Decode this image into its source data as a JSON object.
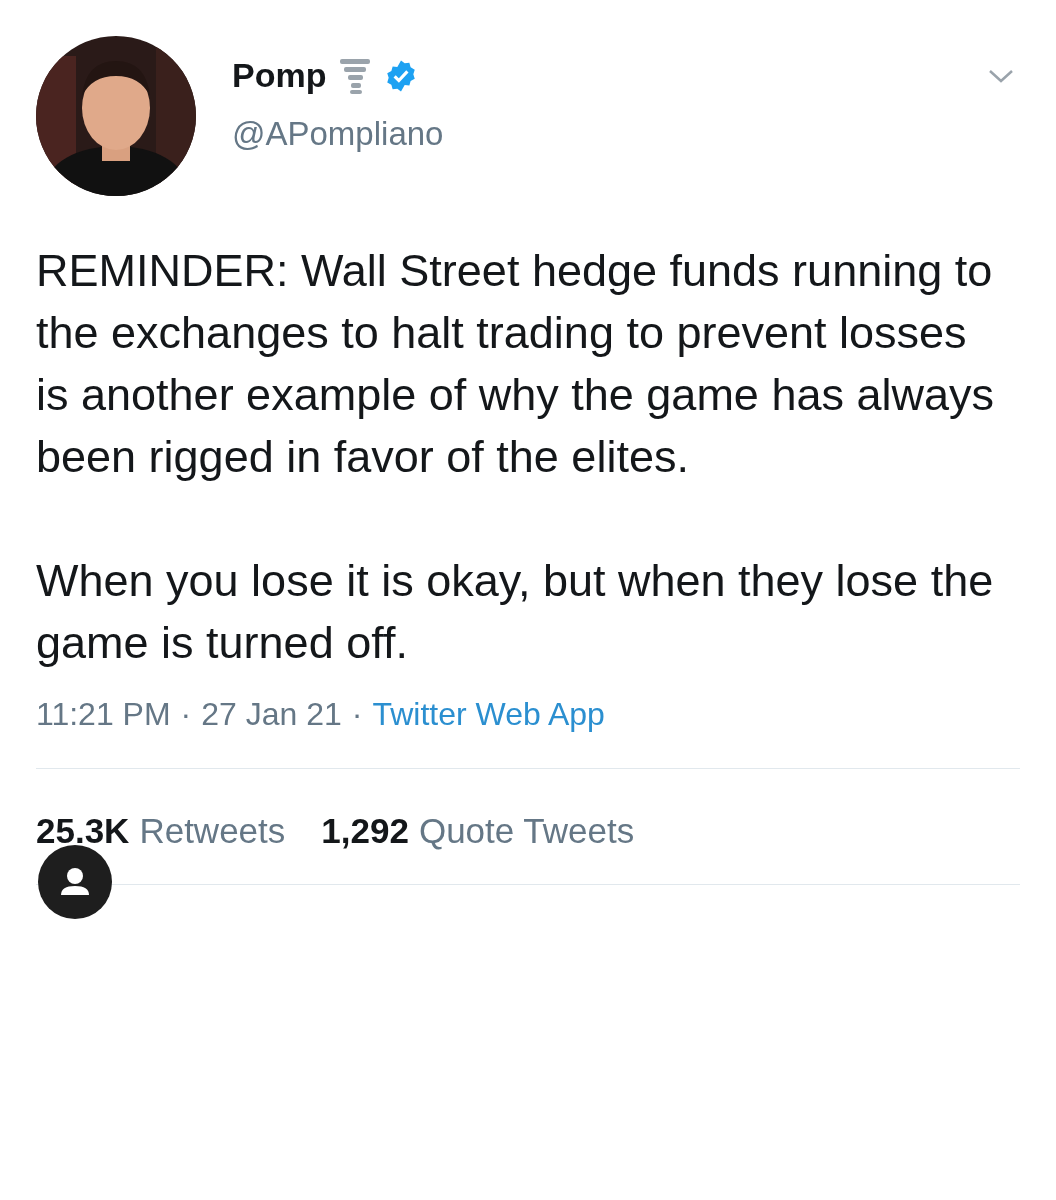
{
  "author": {
    "name": "Pomp",
    "handle": "@APompliano",
    "verified": true
  },
  "body": [
    "REMINDER: Wall Street hedge funds running to the exchanges to halt trading to prevent losses is another example of why the game has always been rigged in favor of the elites.",
    "When you lose it is okay, but when they lose the game is turned off."
  ],
  "meta": {
    "time": "11:21 PM",
    "date": "27 Jan 21",
    "source": "Twitter Web App",
    "separator": "·"
  },
  "stats": [
    {
      "count": "25.3K",
      "label": "Retweets"
    },
    {
      "count": "1,292",
      "label": "Quote Tweets"
    }
  ]
}
